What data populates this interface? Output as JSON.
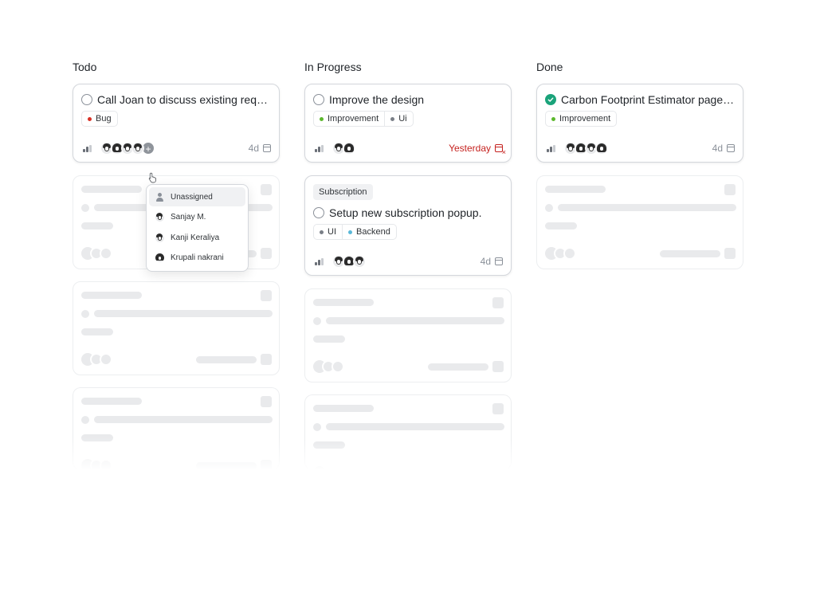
{
  "columns": [
    {
      "title": "Todo",
      "card": {
        "title": "Call Joan to discuss existing requir...",
        "tags": [
          {
            "label": "Bug",
            "color": "#d93025"
          }
        ],
        "due": "4d"
      }
    },
    {
      "title": "In Progress",
      "cards": [
        {
          "title": "Improve the design",
          "tags": [
            {
              "label": "Improvement",
              "color": "#5cb82d"
            },
            {
              "label": "Ui",
              "color": "#7a7f87"
            }
          ],
          "due": "Yesterday"
        },
        {
          "project": "Subscription",
          "title": "Setup new subscription popup.",
          "tags": [
            {
              "label": "UI",
              "color": "#7a7f87"
            },
            {
              "label": "Backend",
              "color": "#5ab8d8"
            }
          ],
          "due": "4d"
        }
      ]
    },
    {
      "title": "Done",
      "card": {
        "title": "Carbon Footprint Estimator page d...",
        "tags": [
          {
            "label": "Improvement",
            "color": "#5cb82d"
          }
        ],
        "due": "4d"
      }
    }
  ],
  "assignee_menu": {
    "items": [
      "Unassigned",
      "Sanjay M.",
      "Kanji Keraliya",
      "Krupali nakrani"
    ]
  },
  "colors": {
    "done": "#1aa37a",
    "overdue": "#c5221f"
  }
}
